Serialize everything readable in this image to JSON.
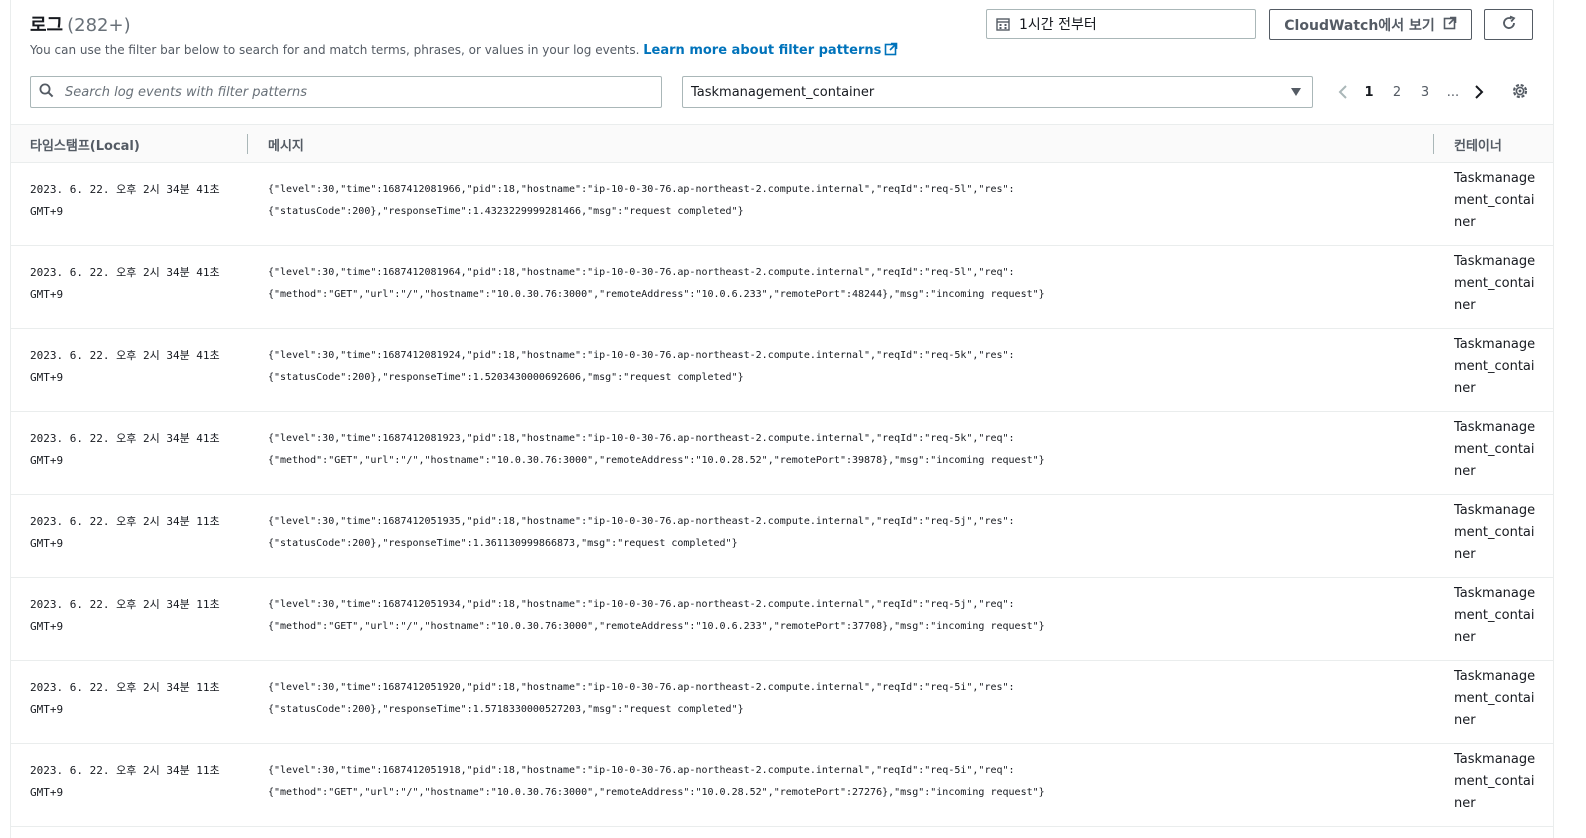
{
  "header": {
    "title": "로그",
    "count": "(282+)",
    "description": "You can use the filter bar below to search for and match terms, phrases, or values in your log events.",
    "learn_more": "Learn more about filter patterns",
    "time_range": "1시간 전부터",
    "cloudwatch_button": "CloudWatch에서 보기"
  },
  "filter": {
    "search_placeholder": "Search log events with filter patterns",
    "container_selected": "Taskmanagement_container"
  },
  "pagination": {
    "pages": [
      "1",
      "2",
      "3"
    ],
    "ellipsis": "...",
    "current": "1"
  },
  "table": {
    "columns": [
      "타임스탬프(Local)",
      "메시지",
      "컨테이너"
    ],
    "rows": [
      {
        "timestamp": "2023. 6. 22. 오후 2시 34분 41초 GMT+9",
        "message_1": "{\"level\":30,\"time\":1687412081966,\"pid\":18,\"hostname\":\"ip-10-0-30-76.ap-northeast-2.compute.internal\",\"reqId\":\"req-5l\",\"res\":",
        "message_2": "{\"statusCode\":200},\"responseTime\":1.4323229999281466,\"msg\":\"request completed\"}",
        "container": "Taskmanagement_container"
      },
      {
        "timestamp": "2023. 6. 22. 오후 2시 34분 41초 GMT+9",
        "message_1": "{\"level\":30,\"time\":1687412081964,\"pid\":18,\"hostname\":\"ip-10-0-30-76.ap-northeast-2.compute.internal\",\"reqId\":\"req-5l\",\"req\":",
        "message_2": "{\"method\":\"GET\",\"url\":\"/\",\"hostname\":\"10.0.30.76:3000\",\"remoteAddress\":\"10.0.6.233\",\"remotePort\":48244},\"msg\":\"incoming request\"}",
        "container": "Taskmanagement_container"
      },
      {
        "timestamp": "2023. 6. 22. 오후 2시 34분 41초 GMT+9",
        "message_1": "{\"level\":30,\"time\":1687412081924,\"pid\":18,\"hostname\":\"ip-10-0-30-76.ap-northeast-2.compute.internal\",\"reqId\":\"req-5k\",\"res\":",
        "message_2": "{\"statusCode\":200},\"responseTime\":1.5203430000692606,\"msg\":\"request completed\"}",
        "container": "Taskmanagement_container"
      },
      {
        "timestamp": "2023. 6. 22. 오후 2시 34분 41초 GMT+9",
        "message_1": "{\"level\":30,\"time\":1687412081923,\"pid\":18,\"hostname\":\"ip-10-0-30-76.ap-northeast-2.compute.internal\",\"reqId\":\"req-5k\",\"req\":",
        "message_2": "{\"method\":\"GET\",\"url\":\"/\",\"hostname\":\"10.0.30.76:3000\",\"remoteAddress\":\"10.0.28.52\",\"remotePort\":39878},\"msg\":\"incoming request\"}",
        "container": "Taskmanagement_container"
      },
      {
        "timestamp": "2023. 6. 22. 오후 2시 34분 11초 GMT+9",
        "message_1": "{\"level\":30,\"time\":1687412051935,\"pid\":18,\"hostname\":\"ip-10-0-30-76.ap-northeast-2.compute.internal\",\"reqId\":\"req-5j\",\"res\":",
        "message_2": "{\"statusCode\":200},\"responseTime\":1.361130999866873,\"msg\":\"request completed\"}",
        "container": "Taskmanagement_container"
      },
      {
        "timestamp": "2023. 6. 22. 오후 2시 34분 11초 GMT+9",
        "message_1": "{\"level\":30,\"time\":1687412051934,\"pid\":18,\"hostname\":\"ip-10-0-30-76.ap-northeast-2.compute.internal\",\"reqId\":\"req-5j\",\"req\":",
        "message_2": "{\"method\":\"GET\",\"url\":\"/\",\"hostname\":\"10.0.30.76:3000\",\"remoteAddress\":\"10.0.6.233\",\"remotePort\":37708},\"msg\":\"incoming request\"}",
        "container": "Taskmanagement_container"
      },
      {
        "timestamp": "2023. 6. 22. 오후 2시 34분 11초 GMT+9",
        "message_1": "{\"level\":30,\"time\":1687412051920,\"pid\":18,\"hostname\":\"ip-10-0-30-76.ap-northeast-2.compute.internal\",\"reqId\":\"req-5i\",\"res\":",
        "message_2": "{\"statusCode\":200},\"responseTime\":1.5718330000527203,\"msg\":\"request completed\"}",
        "container": "Taskmanagement_container"
      },
      {
        "timestamp": "2023. 6. 22. 오후 2시 34분 11초 GMT+9",
        "message_1": "{\"level\":30,\"time\":1687412051918,\"pid\":18,\"hostname\":\"ip-10-0-30-76.ap-northeast-2.compute.internal\",\"reqId\":\"req-5i\",\"req\":",
        "message_2": "{\"method\":\"GET\",\"url\":\"/\",\"hostname\":\"10.0.30.76:3000\",\"remoteAddress\":\"10.0.28.52\",\"remotePort\":27276},\"msg\":\"incoming request\"}",
        "container": "Taskmanagement_container"
      }
    ]
  },
  "colors": {
    "link": "#0073bb",
    "text": "#16191f",
    "muted": "#687078",
    "border": "#aab7b8"
  },
  "icons": [
    "external-link-icon",
    "calendar-icon",
    "refresh-icon",
    "search-icon",
    "caret-down-icon",
    "chevron-left-icon",
    "chevron-right-icon",
    "gear-icon"
  ]
}
